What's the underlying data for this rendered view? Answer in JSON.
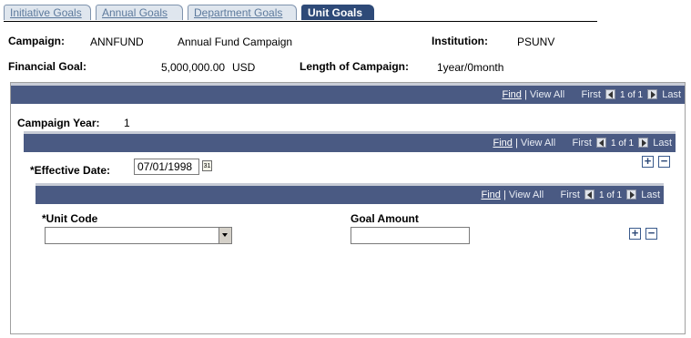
{
  "tabs": [
    {
      "label": "Initiative Goals"
    },
    {
      "label": "Annual Goals"
    },
    {
      "label": "Department Goals"
    },
    {
      "label": "Unit Goals"
    }
  ],
  "header": {
    "campaign_label": "Campaign:",
    "campaign_code": "ANNFUND",
    "campaign_name": "Annual Fund Campaign",
    "institution_label": "Institution:",
    "institution_value": "PSUNV",
    "financial_goal_label": "Financial Goal:",
    "financial_goal_value": "5,000,000.00",
    "currency": "USD",
    "length_label": "Length of Campaign:",
    "length_value": "1year/0month"
  },
  "nav": {
    "find": "Find",
    "sep": "|",
    "view_all": "View All",
    "first": "First",
    "of": "1 of 1",
    "last": "Last"
  },
  "campaign_year": {
    "label": "Campaign Year:",
    "value": "1"
  },
  "effective": {
    "label": "*Effective Date:",
    "value": "07/01/1998",
    "calendar_glyph": "31"
  },
  "unit": {
    "unit_code_label": "*Unit Code",
    "unit_code_value": "",
    "goal_amount_label": "Goal Amount",
    "goal_amount_value": ""
  },
  "icons": {
    "add": "+",
    "remove": "−"
  },
  "colors": {
    "bar": "#4a5a83",
    "active_tab": "#2e4a78"
  }
}
